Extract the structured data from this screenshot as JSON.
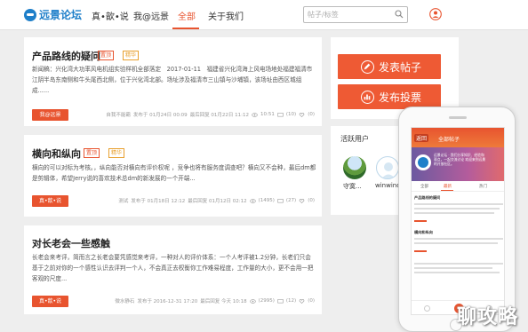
{
  "nav": {
    "logo": "远景论坛",
    "items": [
      "真•歆•说",
      "我@远景",
      "全部",
      "关于我们"
    ],
    "active": "全部",
    "search_placeholder": "帖子/标签"
  },
  "posts": [
    {
      "title": "产品路线的疑问",
      "tags": [
        "置顶",
        "精华"
      ],
      "body": "新闻稿：兴化湾大功率风电机组实验样机全部落定　2017-01-11　福建省兴化湾海上风电场地处福建福清市江阴半岛东南侧和牛头尾西北侧，位于兴化湾北部。场址涉及福清市三山镇与沙埔镇，该场址由西区城组成......",
      "button": "我@远景",
      "meta": {
        "author": "自我不能霸",
        "posted": "发布于 01月24日 00:09",
        "last_reply": "最后回复 01月22日 11:12",
        "views": "10:51",
        "replies": "(10)",
        "likes": "(0)"
      }
    },
    {
      "title": "横向和纵向",
      "tags": [
        "置顶",
        "精华"
      ],
      "body": "横向的可以对标为考核。，纵向能否对横向有评价权呢 ，竞争也将有服务度调查吧？横向又不会种，最后dm都是剪辑体，希望Jerry说的喜欢技术总dm的新发展的一个开端...",
      "button": "真•歆•说",
      "meta": {
        "author": "测试",
        "posted": "发布于 01月18日 12:12",
        "last_reply": "最后回复 01月12日 02:12",
        "views": "(1495)",
        "replies": "(27)",
        "likes": "(0)"
      }
    },
    {
      "title": "对长老会一些感触",
      "tags": [],
      "body": "长老会来考评，简而言之长老会要凭感觉来考评，一种对人的评价体系：一个人考评被1.2分钟，长老们只会基于之前对你的一个感性认识去评判一个人，不会真正去权衡你工作难易程度，工作量的大小，更不会用一把客观的尺度...",
      "button": "真•歆•说",
      "meta": {
        "author": "微水静石",
        "posted": "发布于 2016-12-31 17:20",
        "last_reply": "最后回复 今天 10:18",
        "views": "(2995)",
        "replies": "(12)",
        "likes": "(0)"
      }
    }
  ],
  "sidebar": {
    "post_button": "发表帖子",
    "poll_button": "发布投票",
    "active_users_title": "活跃用户",
    "users": [
      {
        "name": "守寞..."
      },
      {
        "name": "winwind"
      }
    ]
  },
  "phone": {
    "back": "返回",
    "title": "全部帖子",
    "hero_text": "远景论坛 · 我们分享知识、经验和观点，一起交流讨论 欢迎来到远景的开放社区。",
    "tabs": [
      "全部",
      "最新",
      "热门"
    ],
    "active_tab": "最新",
    "post_titles": [
      "产品路线的疑问",
      "横向和纵向"
    ]
  },
  "watermark": "聊攻略",
  "colors": {
    "accent": "#e8542f",
    "brand": "#1e7fc9"
  }
}
